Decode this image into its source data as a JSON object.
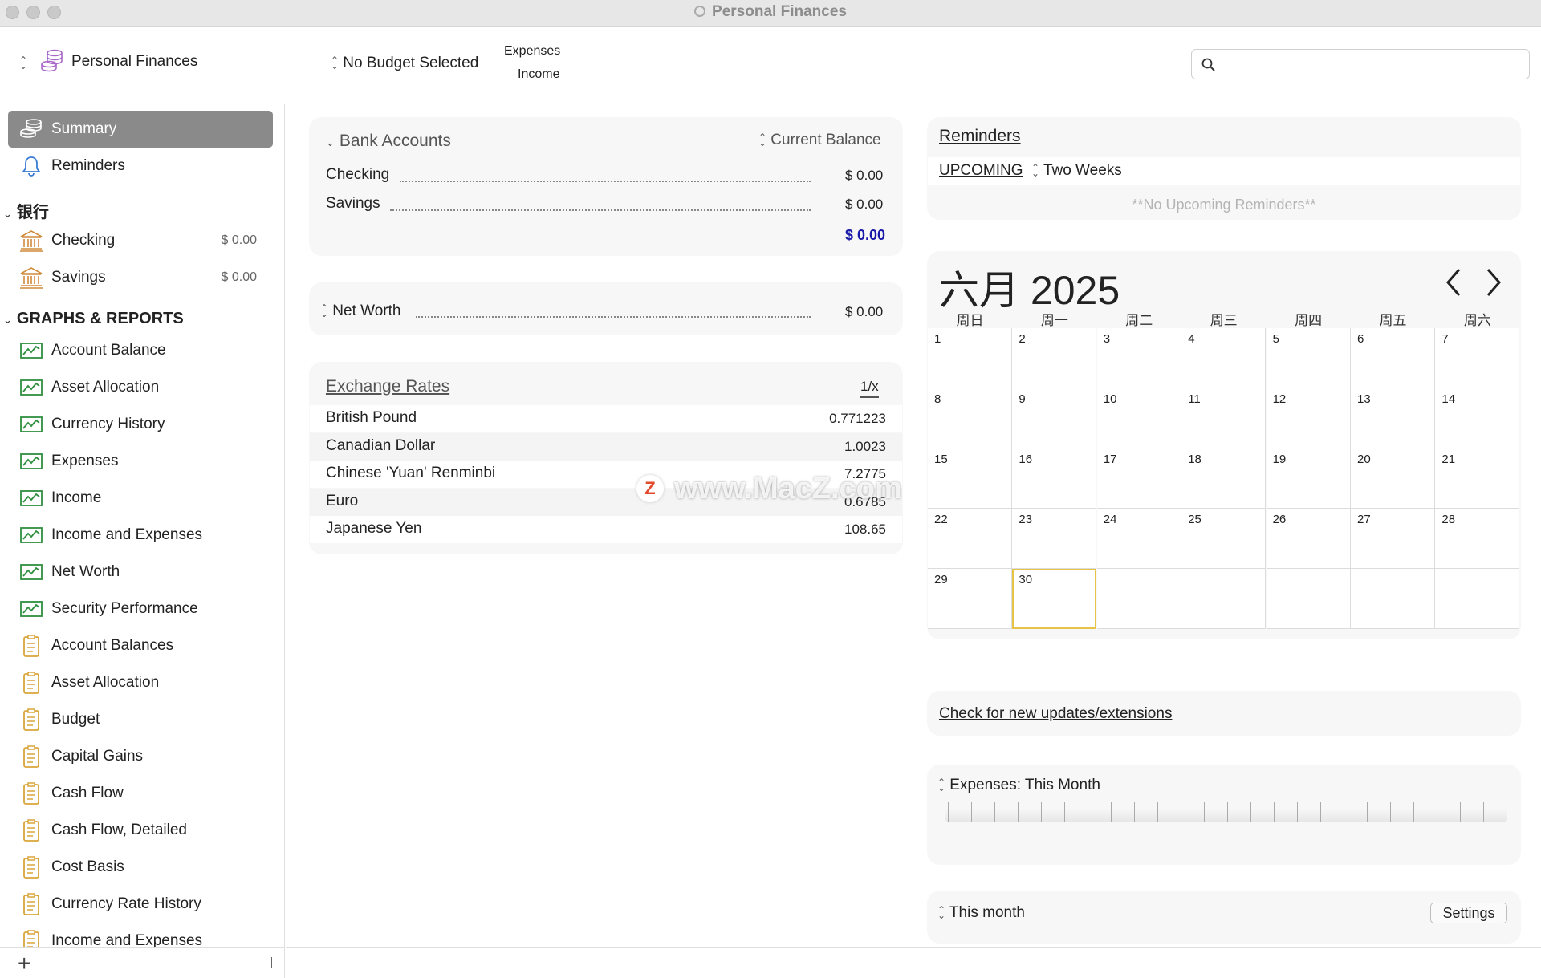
{
  "window": {
    "title": "Personal Finances"
  },
  "toolbar": {
    "account_file": "Personal Finances",
    "budget": "No Budget Selected",
    "toggle_top": "Expenses",
    "toggle_bottom": "Income",
    "search_placeholder": ""
  },
  "sidebar": {
    "top_items": [
      {
        "label": "Summary",
        "icon": "coins-icon"
      },
      {
        "label": "Reminders",
        "icon": "bell-icon"
      }
    ],
    "bank_section": "银行",
    "bank_items": [
      {
        "label": "Checking",
        "amount": "$ 0.00",
        "icon": "bank-icon"
      },
      {
        "label": "Savings",
        "amount": "$ 0.00",
        "icon": "bank-icon"
      }
    ],
    "graphs_section": "GRAPHS & REPORTS",
    "graph_items": [
      "Account Balance",
      "Asset Allocation",
      "Currency History",
      "Expenses",
      "Income",
      "Income and Expenses",
      "Net Worth",
      "Security Performance"
    ],
    "report_items": [
      "Account Balances",
      "Asset Allocation",
      "Budget",
      "Capital Gains",
      "Cash Flow",
      "Cash Flow, Detailed",
      "Cost Basis",
      "Currency Rate History",
      "Income and Expenses"
    ]
  },
  "bank_accounts": {
    "title": "Bank Accounts",
    "column": "Current Balance",
    "rows": [
      {
        "name": "Checking",
        "value": "$ 0.00"
      },
      {
        "name": "Savings",
        "value": "$ 0.00"
      }
    ],
    "total": "$ 0.00",
    "total_color": "#1a1aa8"
  },
  "net_worth": {
    "label": "Net Worth",
    "value": "$ 0.00"
  },
  "exchange_rates": {
    "title": "Exchange Rates",
    "toggle": "1/x",
    "rows": [
      {
        "currency": "British Pound",
        "rate": "0.771223"
      },
      {
        "currency": "Canadian Dollar",
        "rate": "1.0023"
      },
      {
        "currency": "Chinese 'Yuan' Renminbi",
        "rate": "7.2775"
      },
      {
        "currency": "Euro",
        "rate": "0.6785"
      },
      {
        "currency": "Japanese Yen",
        "rate": "108.65"
      }
    ]
  },
  "watermark": {
    "text": "www.MacZ.com",
    "badge": "Z"
  },
  "reminders": {
    "title": "Reminders",
    "upcoming": "UPCOMING",
    "period": "Two Weeks",
    "empty": "**No Upcoming Reminders**"
  },
  "calendar": {
    "month_title": "六月 2025",
    "weekdays": [
      "周日",
      "周一",
      "周二",
      "周三",
      "周四",
      "周五",
      "周六"
    ],
    "days": [
      "1",
      "2",
      "3",
      "4",
      "5",
      "6",
      "7",
      "8",
      "9",
      "10",
      "11",
      "12",
      "13",
      "14",
      "15",
      "16",
      "17",
      "18",
      "19",
      "20",
      "21",
      "22",
      "23",
      "24",
      "25",
      "26",
      "27",
      "28",
      "29",
      "30",
      "",
      "",
      "",
      "",
      ""
    ],
    "today": "30",
    "today_color": "#e8c34a"
  },
  "updates_link": "Check for new updates/extensions",
  "expenses_panel": {
    "title": "Expenses: This Month"
  },
  "this_month_panel": {
    "title": "This month",
    "settings": "Settings"
  }
}
